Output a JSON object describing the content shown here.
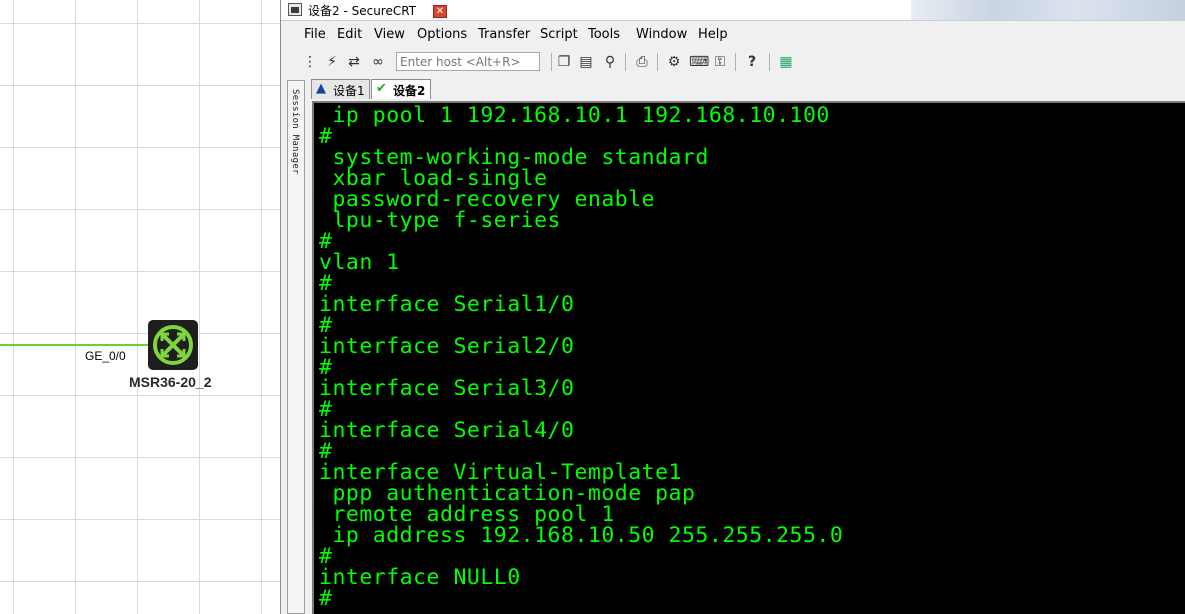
{
  "topology": {
    "port_label": "GE_0/0",
    "device_name": "MSR36-20_2",
    "colors": {
      "link": "#6ccf3a",
      "device_accent": "#7fd63a"
    }
  },
  "window": {
    "title": "设备2 - SecureCRT"
  },
  "menu": [
    "File",
    "Edit",
    "View",
    "Options",
    "Transfer",
    "Script",
    "Tools",
    "Window",
    "Help"
  ],
  "toolbar": {
    "host_placeholder": "Enter host <Alt+R>",
    "icons": [
      "connect-tree-icon",
      "quick-connect-icon",
      "reconnect-icon",
      "link-icon",
      "copy-icon",
      "paste-icon",
      "find-icon",
      "print-icon",
      "settings-icon",
      "keymap-icon",
      "key-icon",
      "help-icon",
      "sftp-icon"
    ]
  },
  "session_manager": {
    "label": "Session Manager"
  },
  "tabs": [
    {
      "label": "设备1",
      "status_icon": "warning-icon"
    },
    {
      "label": "设备2",
      "status_icon": "check-icon"
    }
  ],
  "terminal": {
    "text_color": "#00ff00",
    "lines": [
      " ip pool 1 192.168.10.1 192.168.10.100",
      "#",
      " system-working-mode standard",
      " xbar load-single",
      " password-recovery enable",
      " lpu-type f-series",
      "#",
      "vlan 1",
      "#",
      "interface Serial1/0",
      "#",
      "interface Serial2/0",
      "#",
      "interface Serial3/0",
      "#",
      "interface Serial4/0",
      "#",
      "interface Virtual-Template1",
      " ppp authentication-mode pap",
      " remote address pool 1",
      " ip address 192.168.10.50 255.255.255.0",
      "#",
      "interface NULL0",
      "#"
    ]
  }
}
